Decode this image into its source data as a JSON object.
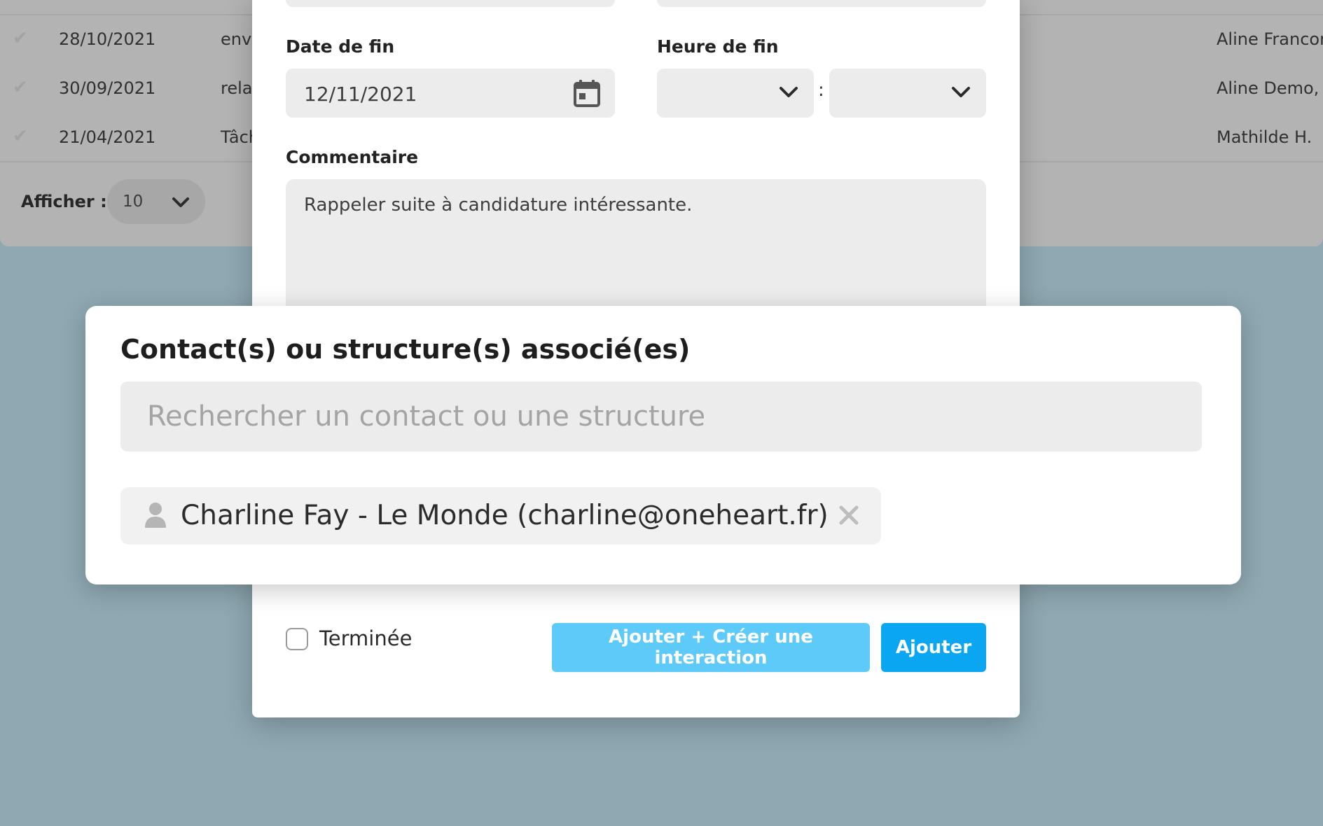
{
  "background_list": {
    "rows": [
      {
        "date": "28/10/2021",
        "subject": "envo",
        "owner": "Aline Francon"
      },
      {
        "date": "30/09/2021",
        "subject": "relan",
        "owner": "Aline Demo, M"
      },
      {
        "date": "21/04/2021",
        "subject": "Tâch",
        "owner": "Mathilde H."
      }
    ],
    "show_label": "Afficher :",
    "show_value": "10"
  },
  "form": {
    "end_date_label": "Date de fin",
    "end_date_value": "12/11/2021",
    "end_time_label": "Heure de fin",
    "time_separator": ":",
    "comment_label": "Commentaire",
    "comment_value": "Rappeler suite à candidature intéressante.",
    "done_label": "Terminée",
    "add_create_interaction_label": "Ajouter + Créer une interaction",
    "add_label": "Ajouter"
  },
  "contacts": {
    "title": "Contact(s) ou structure(s) associé(es)",
    "search_placeholder": "Rechercher un contact ou une structure",
    "selected": [
      {
        "label": "Charline Fay - Le Monde (charline@oneheart.fr)"
      }
    ]
  },
  "colors": {
    "primary_button": "#0aa6f2",
    "secondary_button": "#5ecaf9",
    "backdrop": "#8fa8b2",
    "field_background": "#ececec"
  },
  "icons": {
    "row_status": "check-icon",
    "date_picker": "calendar-icon",
    "select_arrow": "chevron-down-icon",
    "contact_type": "person-icon",
    "remove_contact": "close-icon"
  }
}
